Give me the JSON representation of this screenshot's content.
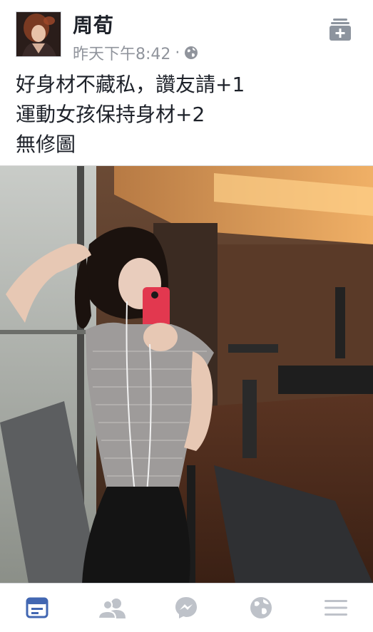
{
  "post": {
    "author": "周荀",
    "timestamp": "昨天下午8:42",
    "separator": "·",
    "privacy_icon": "globe-icon",
    "caption_lines": [
      "好身材不藏私，讚友請+1",
      "運動女孩保持身材+2",
      "無修圖"
    ]
  },
  "tabbar": {
    "items": [
      {
        "name": "news-feed-icon",
        "active": true
      },
      {
        "name": "friends-icon",
        "active": false
      },
      {
        "name": "messenger-icon",
        "active": false
      },
      {
        "name": "notifications-globe-icon",
        "active": false
      },
      {
        "name": "menu-icon",
        "active": false
      }
    ]
  },
  "colors": {
    "accent": "#4267b2",
    "inactive_icon": "#bec2c9",
    "meta_text": "#90949c"
  }
}
